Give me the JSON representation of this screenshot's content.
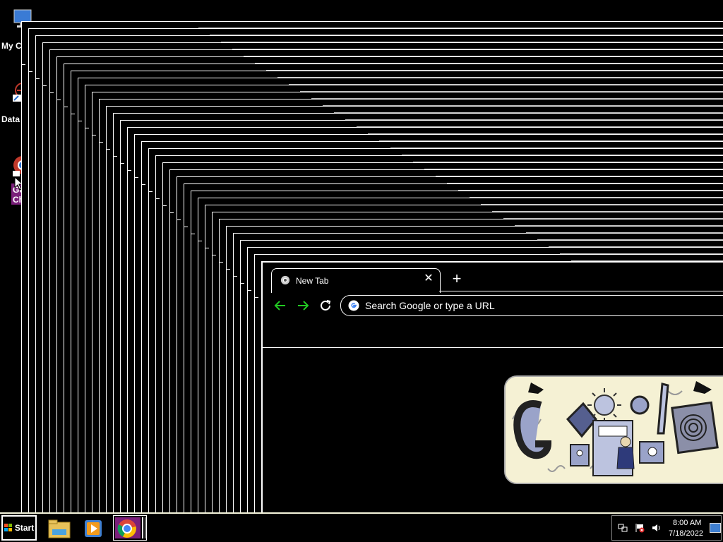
{
  "desktop": {
    "icons": [
      {
        "label": "My C",
        "icon": "my-computer-icon"
      },
      {
        "label": "Data",
        "icon": "database-shortcut-icon"
      },
      {
        "label": "Go",
        "icon": "google-chrome-shortcut-icon"
      },
      {
        "label": "Ch",
        "icon": "google-chrome-shortcut-icon"
      }
    ]
  },
  "browser": {
    "tab_title": "New Tab",
    "tab_close": "✕",
    "new_tab": "+",
    "address_placeholder": "Search Google or type a URL"
  },
  "doodle": {
    "alt": "Google Doodle"
  },
  "taskbar": {
    "start_label": "Start",
    "apps": [
      "file-explorer-icon",
      "media-player-icon",
      "chrome-icon"
    ],
    "clock_time": "8:00 AM",
    "clock_date": "7/18/2022"
  },
  "colors": {
    "background": "#000000",
    "nav_arrow": "#22cc22",
    "taskbar_border": "#f5f5dc"
  }
}
